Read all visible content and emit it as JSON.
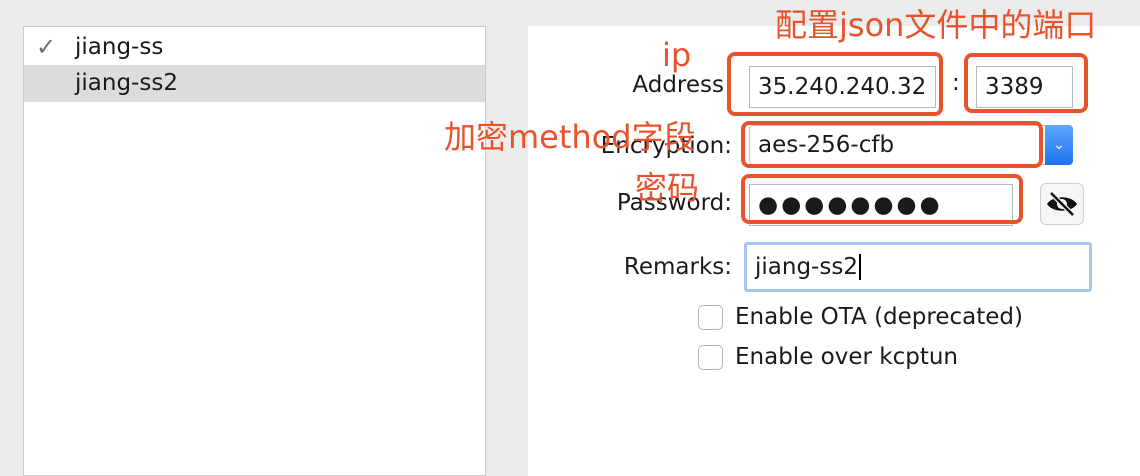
{
  "servers": [
    {
      "name": "jiang-ss",
      "active": true
    },
    {
      "name": "jiang-ss2",
      "active": false
    }
  ],
  "form": {
    "address_label": "Address",
    "address_value": "35.240.240.32",
    "port_separator": ":",
    "port_value": "3389",
    "encryption_label": "Encryption:",
    "encryption_value": "aes-256-cfb",
    "password_label": "Password:",
    "password_value": "●●●●●●●●",
    "remarks_label": "Remarks:",
    "remarks_value": "jiang-ss2",
    "ota_label": "Enable OTA (deprecated)",
    "ota_checked": false,
    "kcptun_label": "Enable over kcptun",
    "kcptun_checked": false
  },
  "annotations": {
    "port": "配置json文件中的端口",
    "ip": "ip",
    "encryption": "加密method字段",
    "password": "密码"
  },
  "icons": {
    "check": "checkmark-icon",
    "select": "chevron-updown-icon",
    "eye": "eye-slash-icon"
  },
  "colors": {
    "annotation": "#e8532c",
    "focus_ring": "#a7c6f3",
    "select_accent": "#1d74f0",
    "selected_row": "#dcdcdc"
  }
}
